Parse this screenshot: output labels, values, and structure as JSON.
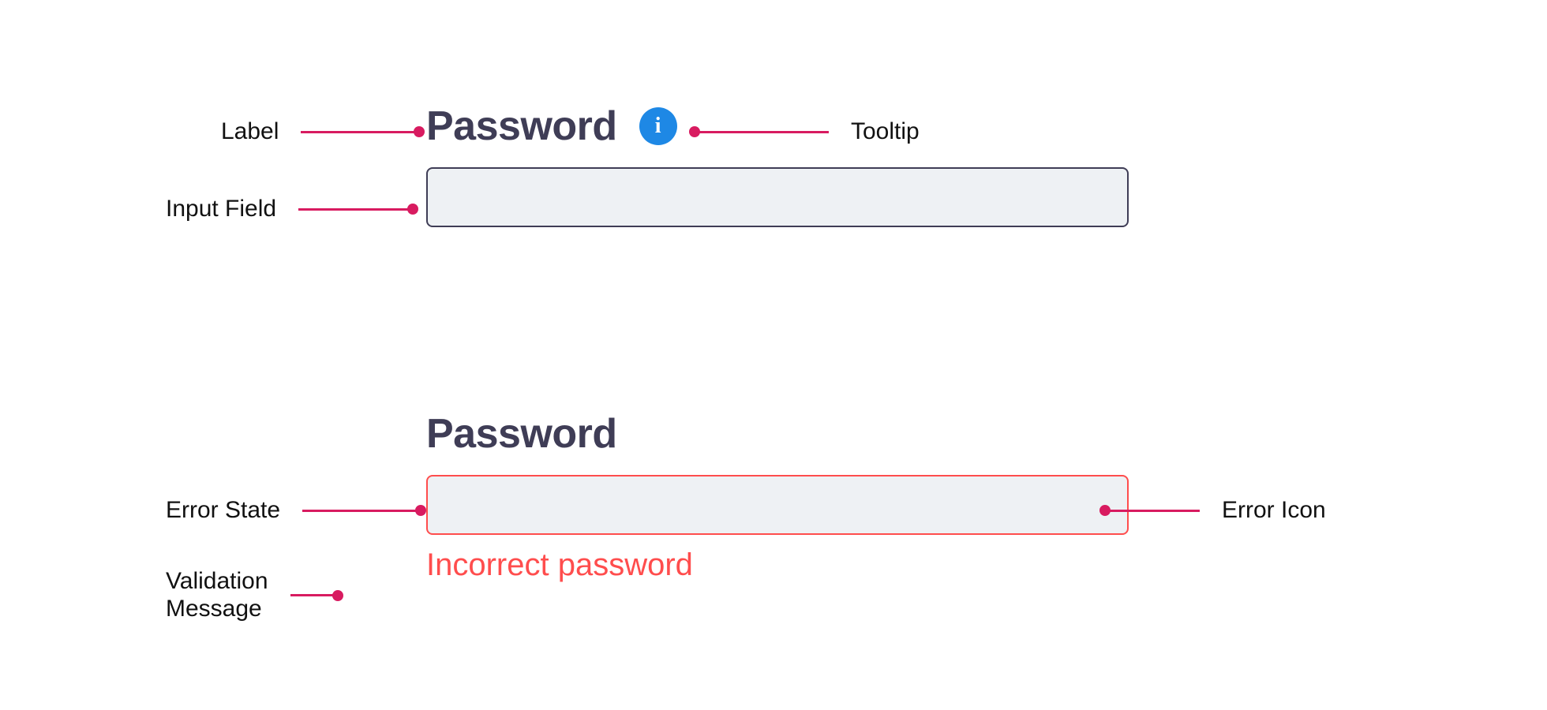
{
  "colors": {
    "accent": "#d81b60",
    "info": "#1e88e5",
    "error": "#ff4d4d",
    "label": "#3f3d56",
    "inputBg": "#eef1f4"
  },
  "field_default": {
    "label": "Password",
    "value": "",
    "tooltip_icon": "info-icon"
  },
  "field_error": {
    "label": "Password",
    "value": "",
    "error_icon": "error-icon",
    "validation_message": "Incorrect password"
  },
  "annotations": {
    "label": "Label",
    "tooltip": "Tooltip",
    "input_field": "Input Field",
    "error_state": "Error State",
    "validation_message_l1": "Validation",
    "validation_message_l2": "Message",
    "error_icon": "Error Icon"
  }
}
